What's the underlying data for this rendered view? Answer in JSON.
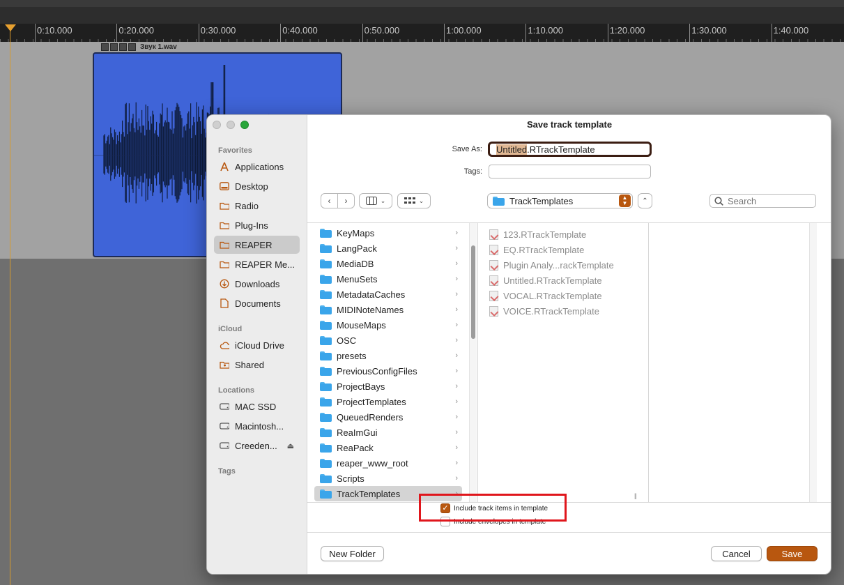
{
  "timeline": {
    "ruler_labels": [
      "0:10.000",
      "0:20.000",
      "0:30.000",
      "0:40.000",
      "0:50.000",
      "1:00.000",
      "1:10.000",
      "1:20.000",
      "1:30.000",
      "1:40.000"
    ],
    "item_name": "Звук 1.wav",
    "colors": {
      "item": "#3f64d8",
      "playhead": "#e6a030"
    }
  },
  "dialog": {
    "title": "Save track template",
    "save_as_label": "Save As:",
    "save_as_value_selected": "Untitled",
    "save_as_value_rest": ".RTrackTemplate",
    "tags_label": "Tags:",
    "current_folder": "TrackTemplates",
    "search_placeholder": "Search",
    "sidebar": {
      "favorites_header": "Favorites",
      "favorites": [
        {
          "label": "Applications",
          "icon": "applications-icon"
        },
        {
          "label": "Desktop",
          "icon": "desktop-icon"
        },
        {
          "label": "Radio",
          "icon": "folder-icon"
        },
        {
          "label": "Plug-Ins",
          "icon": "folder-icon"
        },
        {
          "label": "REAPER",
          "icon": "folder-icon",
          "selected": true
        },
        {
          "label": "REAPER Me...",
          "icon": "folder-icon"
        },
        {
          "label": "Downloads",
          "icon": "downloads-icon"
        },
        {
          "label": "Documents",
          "icon": "documents-icon"
        }
      ],
      "icloud_header": "iCloud",
      "icloud": [
        {
          "label": "iCloud Drive",
          "icon": "cloud-icon"
        },
        {
          "label": "Shared",
          "icon": "shared-folder-icon"
        }
      ],
      "locations_header": "Locations",
      "locations": [
        {
          "label": "MAC SSD",
          "icon": "drive-icon"
        },
        {
          "label": "Macintosh...",
          "icon": "drive-icon"
        },
        {
          "label": "Creeden...",
          "icon": "drive-icon",
          "eject": "⏏"
        }
      ],
      "tags_header": "Tags"
    },
    "folders": [
      "KeyMaps",
      "LangPack",
      "MediaDB",
      "MenuSets",
      "MetadataCaches",
      "MIDINoteNames",
      "MouseMaps",
      "OSC",
      "presets",
      "PreviousConfigFiles",
      "ProjectBays",
      "ProjectTemplates",
      "QueuedRenders",
      "ReaImGui",
      "ReaPack",
      "reaper_www_root",
      "Scripts",
      "TrackTemplates"
    ],
    "selected_folder": "TrackTemplates",
    "files": [
      "123.RTrackTemplate",
      "EQ.RTrackTemplate",
      "Plugin Analy...rackTemplate",
      "Untitled.RTrackTemplate",
      "VOCAL.RTrackTemplate",
      "VOICE.RTrackTemplate"
    ],
    "options": {
      "include_items": {
        "label": "Include track items in template",
        "checked": true
      },
      "include_envelopes": {
        "label": "Include envelopes in template",
        "checked": false
      }
    },
    "buttons": {
      "new_folder": "New Folder",
      "cancel": "Cancel",
      "save": "Save"
    },
    "colors": {
      "accent": "#b8570f",
      "highlight_box": "#e0161c",
      "folder": "#3aa5ea"
    }
  }
}
